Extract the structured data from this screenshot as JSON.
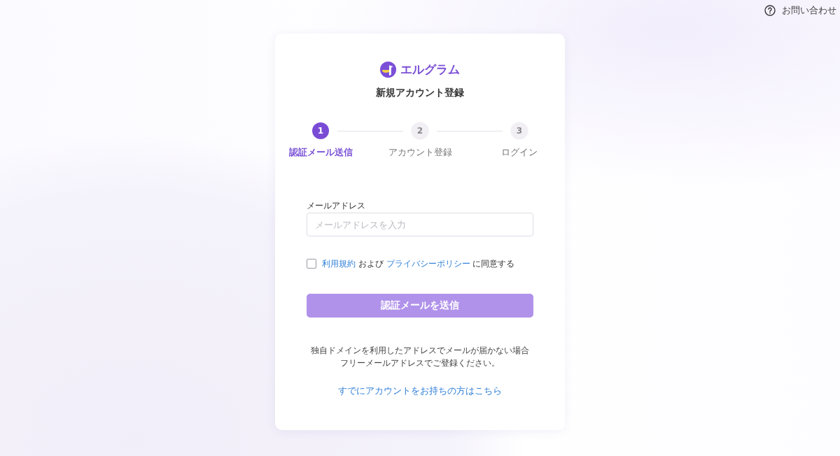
{
  "header": {
    "contact_link": "お問い合わせ"
  },
  "card": {
    "logo": {
      "text": "エルグラム"
    },
    "title": "新規アカウント登録",
    "steps": [
      {
        "number": "1",
        "label": "認証メール送信",
        "selected": true
      },
      {
        "number": "2",
        "label": "アカウント登録",
        "selected": false
      },
      {
        "number": "3",
        "label": "ログイン",
        "selected": false
      }
    ],
    "email_field": {
      "label": "メールアドレス",
      "placeholder": "メールアドレスを入力"
    },
    "agreement": {
      "checked": false,
      "segments": [
        {
          "kind": "link",
          "text": "利用規約"
        },
        {
          "kind": "text",
          "text": "および"
        },
        {
          "kind": "link",
          "text": "プライバシーポリシー"
        },
        {
          "kind": "text",
          "text": "に同意する"
        }
      ]
    },
    "submit_button": {
      "label": "認証メールを送信",
      "disabled": true
    },
    "note_lines": [
      "独自ドメインを利用したアドレスでメールが届かない場合",
      "フリーメールアドレスでご登録ください。"
    ],
    "login_link": "すでにアカウントをお持ちの方はこちら"
  }
}
